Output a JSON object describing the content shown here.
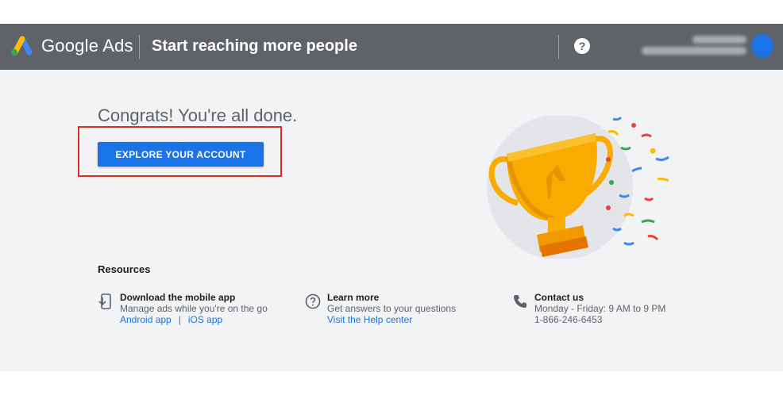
{
  "header": {
    "brand": "Google Ads",
    "title": "Start reaching more people",
    "help_icon": "?"
  },
  "main": {
    "congrats": "Congrats! You're all done.",
    "explore_button": "EXPLORE YOUR ACCOUNT"
  },
  "resources": {
    "title": "Resources",
    "items": [
      {
        "icon": "phone-download-icon",
        "title": "Download the mobile app",
        "desc": "Manage ads while you're on the go",
        "link1": "Android app",
        "separator": "|",
        "link2": "iOS app"
      },
      {
        "icon": "help-circle-icon",
        "title": "Learn more",
        "desc": "Get answers to your questions",
        "link1": "Visit the Help center"
      },
      {
        "icon": "phone-icon",
        "title": "Contact us",
        "desc": "Monday - Friday: 9 AM to 9 PM",
        "line3": "1-866-246-6453"
      }
    ]
  },
  "colors": {
    "header_bg": "#5f6368",
    "content_bg": "#f1f3f4",
    "accent": "#1a73e8",
    "highlight_border": "#d93025",
    "trophy_gold": "#f9ab00"
  }
}
